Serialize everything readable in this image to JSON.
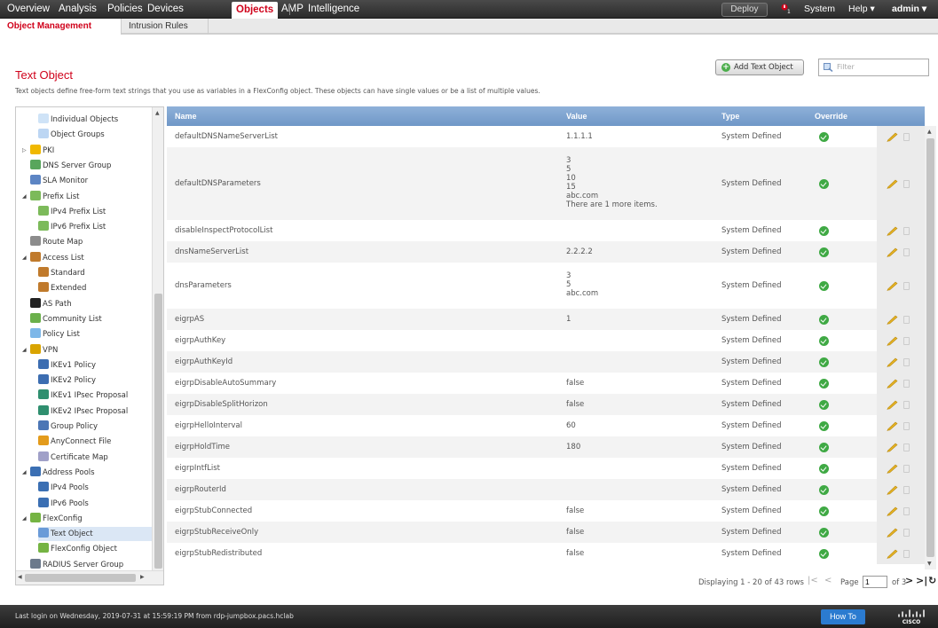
{
  "topnav": {
    "items": [
      "Overview",
      "Analysis",
      "Policies",
      "Devices",
      "Objects",
      "AMP",
      "Intelligence"
    ],
    "active": "Objects",
    "deploy": "Deploy",
    "alert_count": "1",
    "system": "System",
    "help": "Help ▾",
    "admin": "admin ▾"
  },
  "subnav": {
    "items": [
      "Object Management",
      "Intrusion Rules"
    ],
    "active": "Object Management"
  },
  "header": {
    "title": "Text Object",
    "description": "Text objects define free-form text strings that you use as variables in a FlexConfig object. These objects can have single values or be a list of multiple values.",
    "add_button": "Add Text Object",
    "filter_placeholder": "Filter"
  },
  "sidebar": {
    "items": [
      {
        "label": "Individual Objects",
        "icon": "object-icon",
        "level": 2,
        "arrow": ""
      },
      {
        "label": "Object Groups",
        "icon": "object-group-icon",
        "level": 2,
        "arrow": ""
      },
      {
        "label": "PKI",
        "icon": "key-icon",
        "level": 1,
        "arrow": "▷"
      },
      {
        "label": "DNS Server Group",
        "icon": "dns-icon",
        "level": 1,
        "arrow": ""
      },
      {
        "label": "SLA Monitor",
        "icon": "sla-icon",
        "level": 1,
        "arrow": ""
      },
      {
        "label": "Prefix List",
        "icon": "prefix-list-icon",
        "level": 1,
        "arrow": "◢"
      },
      {
        "label": "IPv4 Prefix List",
        "icon": "prefix-list-icon",
        "level": 2,
        "arrow": ""
      },
      {
        "label": "IPv6 Prefix List",
        "icon": "prefix-list-icon",
        "level": 2,
        "arrow": ""
      },
      {
        "label": "Route Map",
        "icon": "route-map-icon",
        "level": 1,
        "arrow": ""
      },
      {
        "label": "Access List",
        "icon": "access-list-icon",
        "level": 1,
        "arrow": "◢"
      },
      {
        "label": "Standard",
        "icon": "access-list-icon",
        "level": 2,
        "arrow": ""
      },
      {
        "label": "Extended",
        "icon": "access-list-icon",
        "level": 2,
        "arrow": ""
      },
      {
        "label": "AS Path",
        "icon": "as-path-icon",
        "level": 1,
        "arrow": ""
      },
      {
        "label": "Community List",
        "icon": "community-icon",
        "level": 1,
        "arrow": ""
      },
      {
        "label": "Policy List",
        "icon": "policy-list-icon",
        "level": 1,
        "arrow": ""
      },
      {
        "label": "VPN",
        "icon": "vpn-icon",
        "level": 1,
        "arrow": "◢"
      },
      {
        "label": "IKEv1 Policy",
        "icon": "ike-policy-icon",
        "level": 2,
        "arrow": ""
      },
      {
        "label": "IKEv2 Policy",
        "icon": "ike-policy-icon",
        "level": 2,
        "arrow": ""
      },
      {
        "label": "IKEv1 IPsec Proposal",
        "icon": "ipsec-icon",
        "level": 2,
        "arrow": ""
      },
      {
        "label": "IKEv2 IPsec Proposal",
        "icon": "ipsec-icon",
        "level": 2,
        "arrow": ""
      },
      {
        "label": "Group Policy",
        "icon": "group-policy-icon",
        "level": 2,
        "arrow": ""
      },
      {
        "label": "AnyConnect File",
        "icon": "file-icon",
        "level": 2,
        "arrow": ""
      },
      {
        "label": "Certificate Map",
        "icon": "certificate-icon",
        "level": 2,
        "arrow": ""
      },
      {
        "label": "Address Pools",
        "icon": "address-pool-icon",
        "level": 1,
        "arrow": "◢"
      },
      {
        "label": "IPv4 Pools",
        "icon": "ipv4-pool-icon",
        "level": 2,
        "arrow": ""
      },
      {
        "label": "IPv6 Pools",
        "icon": "ipv6-pool-icon",
        "level": 2,
        "arrow": ""
      },
      {
        "label": "FlexConfig",
        "icon": "flexconfig-icon",
        "level": 1,
        "arrow": "◢"
      },
      {
        "label": "Text Object",
        "icon": "text-object-icon",
        "level": 2,
        "arrow": "",
        "selected": true
      },
      {
        "label": "FlexConfig Object",
        "icon": "flexconfig-icon",
        "level": 2,
        "arrow": ""
      },
      {
        "label": "RADIUS Server Group",
        "icon": "radius-icon",
        "level": 1,
        "arrow": ""
      }
    ]
  },
  "table": {
    "columns": [
      "Name",
      "Value",
      "Type",
      "Override"
    ],
    "rows": [
      {
        "name": "defaultDNSNameServerList",
        "value": "1.1.1.1",
        "type": "System Defined",
        "override": true,
        "lines": 1
      },
      {
        "name": "defaultDNSParameters",
        "value": "3\n5\n10\n15\nabc.com\nThere are 1 more items.",
        "type": "System Defined",
        "override": true,
        "lines": 6
      },
      {
        "name": "disableInspectProtocolList",
        "value": "",
        "type": "System Defined",
        "override": true,
        "lines": 1
      },
      {
        "name": "dnsNameServerList",
        "value": "2.2.2.2",
        "type": "System Defined",
        "override": true,
        "lines": 1
      },
      {
        "name": "dnsParameters",
        "value": "3\n5\nabc.com",
        "type": "System Defined",
        "override": true,
        "lines": 3
      },
      {
        "name": "eigrpAS",
        "value": "1",
        "type": "System Defined",
        "override": true,
        "lines": 1
      },
      {
        "name": "eigrpAuthKey",
        "value": "",
        "type": "System Defined",
        "override": true,
        "lines": 1
      },
      {
        "name": "eigrpAuthKeyId",
        "value": "",
        "type": "System Defined",
        "override": true,
        "lines": 1
      },
      {
        "name": "eigrpDisableAutoSummary",
        "value": "false",
        "type": "System Defined",
        "override": true,
        "lines": 1
      },
      {
        "name": "eigrpDisableSplitHorizon",
        "value": "false",
        "type": "System Defined",
        "override": true,
        "lines": 1
      },
      {
        "name": "eigrpHelloInterval",
        "value": "60",
        "type": "System Defined",
        "override": true,
        "lines": 1
      },
      {
        "name": "eigrpHoldTime",
        "value": "180",
        "type": "System Defined",
        "override": true,
        "lines": 1
      },
      {
        "name": "eigrpIntfList",
        "value": "",
        "type": "System Defined",
        "override": true,
        "lines": 1
      },
      {
        "name": "eigrpRouterId",
        "value": "",
        "type": "System Defined",
        "override": true,
        "lines": 1
      },
      {
        "name": "eigrpStubConnected",
        "value": "false",
        "type": "System Defined",
        "override": true,
        "lines": 1
      },
      {
        "name": "eigrpStubReceiveOnly",
        "value": "false",
        "type": "System Defined",
        "override": true,
        "lines": 1
      },
      {
        "name": "eigrpStubRedistributed",
        "value": "false",
        "type": "System Defined",
        "override": true,
        "lines": 1
      }
    ]
  },
  "pager": {
    "display_text": "Displaying 1 - 20 of 43 rows",
    "page_label": "Page",
    "page_value": "1",
    "of_text": "of 3"
  },
  "footer": {
    "login_text": "Last login on Wednesday, 2019-07-31 at 15:59:19 PM from rdp-jumpbox.pacs.hclab",
    "howto": "How To",
    "logo_text": "CISCO"
  },
  "colors": {
    "accent": "#d0021b",
    "header_blue": "#7aa0cc",
    "ok_green": "#3fa944",
    "howto_blue": "#2b7bd0"
  }
}
